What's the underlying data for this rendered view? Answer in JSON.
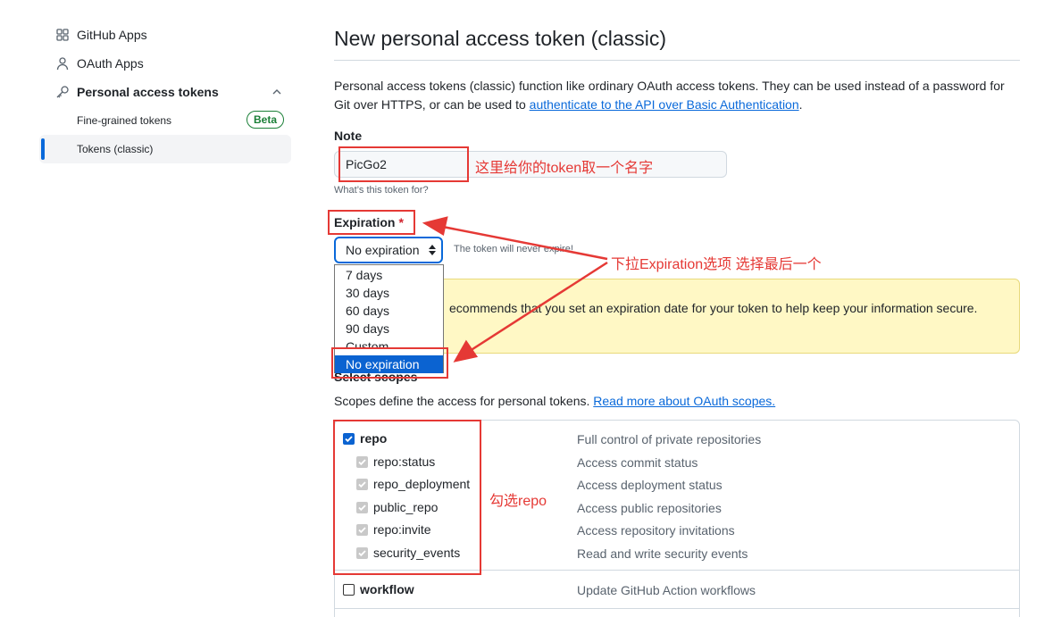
{
  "sidebar": {
    "items": [
      {
        "label": "GitHub Apps",
        "icon": "apps-grid-icon"
      },
      {
        "label": "OAuth Apps",
        "icon": "person-icon"
      },
      {
        "label": "Personal access tokens",
        "icon": "key-icon"
      }
    ],
    "subitems": [
      {
        "label": "Fine-grained tokens",
        "badge": "Beta"
      },
      {
        "label": "Tokens (classic)"
      }
    ]
  },
  "main": {
    "title": "New personal access token (classic)",
    "intro_text": "Personal access tokens (classic) function like ordinary OAuth access tokens. They can be used instead of a password for Git over HTTPS, or can be used to ",
    "intro_link": "authenticate to the API over Basic Authentication",
    "intro_end": ".",
    "note_label": "Note",
    "note_value": "PicGo2",
    "note_hint": "What’s this token for?",
    "expiration_label": "Expiration",
    "required_mark": "*",
    "expiration_selected": "No expiration",
    "expiration_note": "The token will never expire!",
    "expiration_options": [
      "7 days",
      "30 days",
      "60 days",
      "90 days",
      "Custom",
      "No expiration"
    ],
    "warning_text": "ecommends that you set an expiration date for your token to help keep your information secure.",
    "scopes_label": "Select scopes",
    "scopes_desc": "Scopes define the access for personal tokens. ",
    "scopes_link": "Read more about OAuth scopes.",
    "scopes": [
      {
        "name": "repo",
        "desc": "Full control of private repositories",
        "checked": true,
        "level": "parent"
      },
      {
        "name": "repo:status",
        "desc": "Access commit status",
        "checked": true,
        "level": "child"
      },
      {
        "name": "repo_deployment",
        "desc": "Access deployment status",
        "checked": true,
        "level": "child"
      },
      {
        "name": "public_repo",
        "desc": "Access public repositories",
        "checked": true,
        "level": "child"
      },
      {
        "name": "repo:invite",
        "desc": "Access repository invitations",
        "checked": true,
        "level": "child"
      },
      {
        "name": "security_events",
        "desc": "Read and write security events",
        "checked": true,
        "level": "child"
      },
      {
        "name": "workflow",
        "desc": "Update GitHub Action workflows",
        "checked": false,
        "level": "parent"
      }
    ]
  },
  "annotations": {
    "note_tip": "这里给你的token取一个名字",
    "expiration_tip": "下拉Expiration选项 选择最后一个",
    "repo_tip": "勾选repo",
    "color": "#e53935"
  },
  "colors": {
    "accent": "#0969da",
    "success": "#1a7f37",
    "warning_bg": "#fff8c5"
  }
}
